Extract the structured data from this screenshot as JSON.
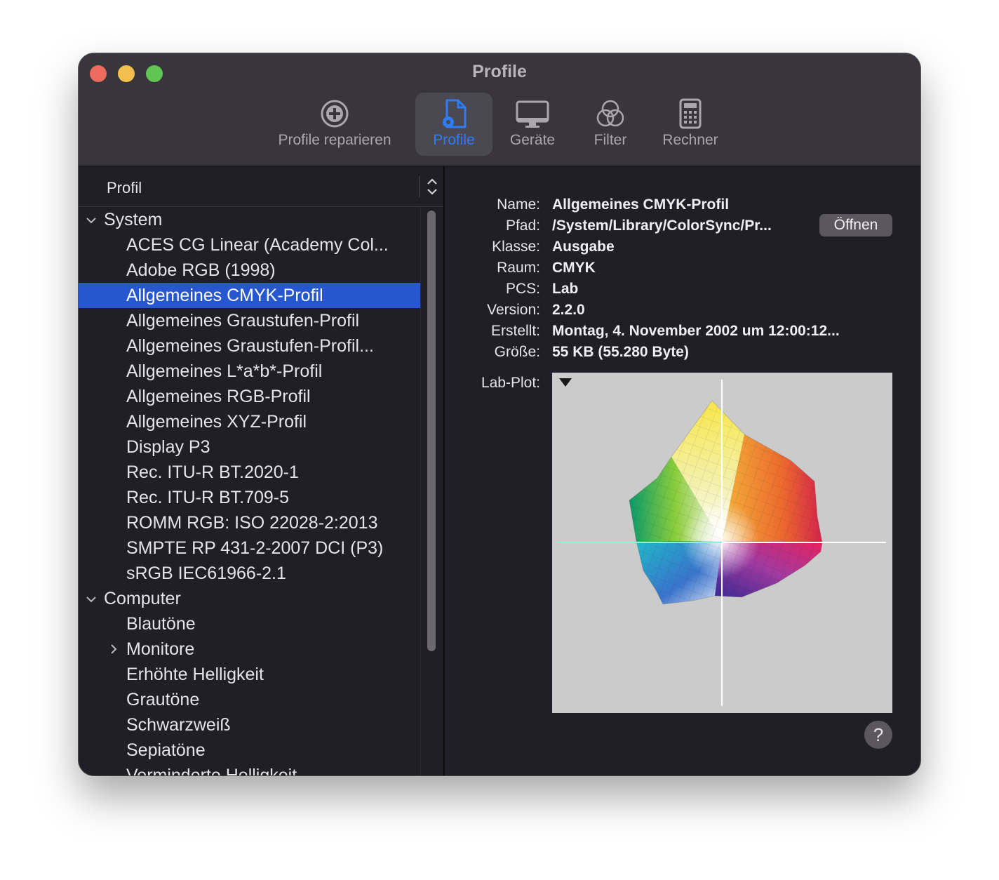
{
  "window": {
    "title": "Profile"
  },
  "toolbar": {
    "items": [
      {
        "label": "Profile reparieren",
        "icon": "repair-plus-icon"
      },
      {
        "label": "Profile",
        "icon": "document-gear-icon",
        "active": true
      },
      {
        "label": "Geräte",
        "icon": "display-icon"
      },
      {
        "label": "Filter",
        "icon": "three-circles-icon"
      },
      {
        "label": "Rechner",
        "icon": "calculator-icon"
      }
    ]
  },
  "sidebar": {
    "column_header": "Profil",
    "groups": [
      {
        "label": "System",
        "expanded": true,
        "items": [
          "ACES CG Linear (Academy Col...",
          "Adobe RGB (1998)",
          "Allgemeines CMYK-Profil",
          "Allgemeines Graustufen-Profil",
          "Allgemeines Graustufen-Profil...",
          "Allgemeines L*a*b*-Profil",
          "Allgemeines RGB-Profil",
          "Allgemeines XYZ-Profil",
          "Display P3",
          "Rec. ITU-R BT.2020-1",
          "Rec. ITU-R BT.709-5",
          "ROMM RGB: ISO 22028-2:2013",
          "SMPTE RP 431-2-2007 DCI (P3)",
          "sRGB IEC61966-2.1"
        ]
      },
      {
        "label": "Computer",
        "expanded": true,
        "items": [
          "Blautöne",
          "Monitore",
          "Erhöhte Helligkeit",
          "Grautöne",
          "Schwarzweiß",
          "Sepiatöne",
          "Verminderte Helligkeit"
        ]
      }
    ],
    "selected": "Allgemeines CMYK-Profil"
  },
  "details": {
    "fields": [
      {
        "label": "Name:",
        "value": "Allgemeines CMYK-Profil"
      },
      {
        "label": "Pfad:",
        "value": "/System/Library/ColorSync/Pr..."
      },
      {
        "label": "Klasse:",
        "value": "Ausgabe"
      },
      {
        "label": "Raum:",
        "value": "CMYK"
      },
      {
        "label": "PCS:",
        "value": "Lab"
      },
      {
        "label": "Version:",
        "value": "2.2.0"
      },
      {
        "label": "Erstellt:",
        "value": "Montag, 4. November 2002 um 12:00:12..."
      },
      {
        "label": "Größe:",
        "value": "55 KB (55.280 Byte)"
      }
    ],
    "open_button": "Öffnen",
    "plot_label": "Lab-Plot:",
    "help_button": "?"
  },
  "colors": {
    "accent": "#2f7cf6",
    "selection": "#2657cf",
    "window_bg": "#201e26",
    "titlebar_bg": "#38363c",
    "plot_bg": "#cbcbcb"
  }
}
